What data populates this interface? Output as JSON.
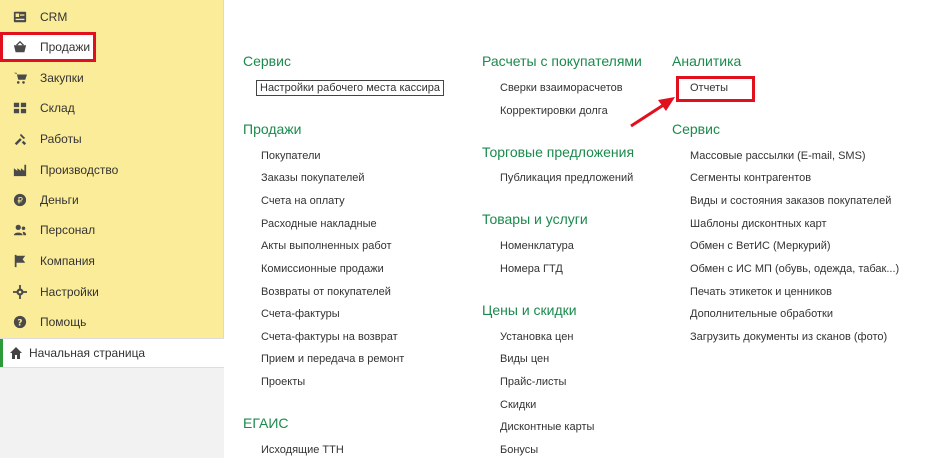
{
  "sidebar": {
    "items": [
      {
        "label": "CRM",
        "icon": "crm-icon"
      },
      {
        "label": "Продажи",
        "icon": "basket-icon"
      },
      {
        "label": "Закупки",
        "icon": "cart-icon"
      },
      {
        "label": "Склад",
        "icon": "warehouse-icon"
      },
      {
        "label": "Работы",
        "icon": "tools-icon"
      },
      {
        "label": "Производство",
        "icon": "factory-icon"
      },
      {
        "label": "Деньги",
        "icon": "money-icon"
      },
      {
        "label": "Персонал",
        "icon": "people-icon"
      },
      {
        "label": "Компания",
        "icon": "flag-icon"
      },
      {
        "label": "Настройки",
        "icon": "gear-icon"
      },
      {
        "label": "Помощь",
        "icon": "help-icon"
      }
    ],
    "home": {
      "label": "Начальная страница",
      "icon": "home-icon"
    }
  },
  "columns": {
    "col1": {
      "service_title": "Сервис",
      "service_items": [
        "Настройки рабочего места кассира"
      ],
      "sales_title": "Продажи",
      "sales_items": [
        "Покупатели",
        "Заказы покупателей",
        "Счета на оплату",
        "Расходные накладные",
        "Акты выполненных работ",
        "Комиссионные продажи",
        "Возвраты от покупателей",
        "Счета-фактуры",
        "Счета-фактуры на возврат",
        "Прием и передача в ремонт",
        "Проекты"
      ],
      "egais_title": "ЕГАИС",
      "egais_items": [
        "Исходящие ТТН"
      ]
    },
    "col2": {
      "settlements_title": "Расчеты с покупателями",
      "settlements_items": [
        "Сверки взаиморасчетов",
        "Корректировки долга"
      ],
      "offers_title": "Торговые предложения",
      "offers_items": [
        "Публикация предложений"
      ],
      "goods_title": "Товары и услуги",
      "goods_items": [
        "Номенклатура",
        "Номера ГТД"
      ],
      "prices_title": "Цены и скидки",
      "prices_items": [
        "Установка цен",
        "Виды цен",
        "Прайс-листы",
        "Скидки",
        "Дисконтные карты",
        "Бонусы"
      ]
    },
    "col3": {
      "analytics_title": "Аналитика",
      "analytics_items": [
        "Отчеты"
      ],
      "service_title": "Сервис",
      "service_items": [
        "Массовые рассылки (E-mail, SMS)",
        "Сегменты контрагентов",
        "Виды и состояния заказов покупателей",
        "Шаблоны дисконтных карт",
        "Обмен с ВетИС (Меркурий)",
        "Обмен с ИС МП (обувь, одежда, табак...)",
        "Печать этикеток и ценников",
        "Дополнительные обработки",
        "Загрузить документы из сканов (фото)"
      ]
    }
  },
  "colors": {
    "sidebar_bg": "#fbec9a",
    "section_title": "#1b8a4c",
    "highlight": "#e0101e"
  }
}
